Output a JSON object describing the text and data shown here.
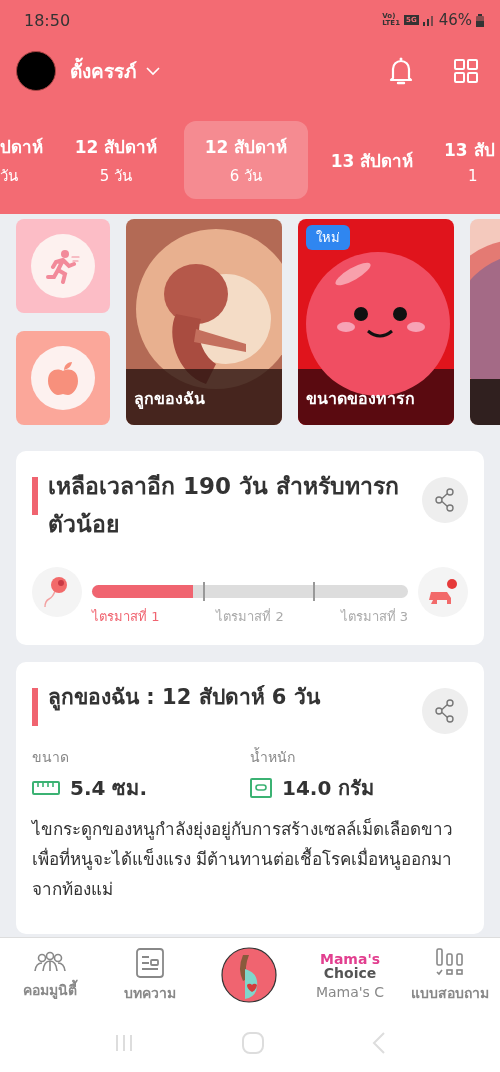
{
  "status_bar": {
    "time": "18:50",
    "volte": "Vo)\nLTE1",
    "network": "5G",
    "battery": "46%"
  },
  "header": {
    "profile_name": "ตั้งครรภ์"
  },
  "week_tabs": [
    {
      "week": "ปดาห์",
      "day": "วัน",
      "selected": false
    },
    {
      "week": "12 สัปดาห์",
      "day": "5 วัน",
      "selected": false
    },
    {
      "week": "12 สัปดาห์",
      "day": "6 วัน",
      "selected": true
    },
    {
      "week": "13 สัปดาห์",
      "selected": false
    },
    {
      "week": "13 สัป",
      "day": "1",
      "selected": false
    }
  ],
  "shortcuts": [
    {
      "kind": "exercise"
    },
    {
      "kind": "nutrition"
    }
  ],
  "feature_cards": [
    {
      "kind": "picture",
      "label": "ลูกของฉัน"
    },
    {
      "kind": "picture",
      "label": "ขนาดของทารก",
      "badge": "ใหม่"
    },
    {
      "kind": "picture"
    }
  ],
  "countdown_card": {
    "title": "เหลือเวลาอีก 190 วัน สำหรับทารกตัวน้อย",
    "level": 0.32,
    "trimesters": [
      {
        "label": "ไตรมาสที่ 1",
        "selected": true
      },
      {
        "label": "ไตรมาสที่ 2",
        "selected": false
      },
      {
        "label": "ไตรมาสที่ 3",
        "selected": false
      }
    ]
  },
  "baby_card": {
    "title": "ลูกของฉัน : 12 สัปดาห์ 6  วัน",
    "size_label": "ขนาด",
    "size_value": "5.4 ซม.",
    "weight_label": "น้ำหนัก",
    "weight_value": "14.0 กรัม",
    "description": "ไขกระดูกของหนูกำลังยุ่งอยู่กับการสร้างเซลล์เม็ดเลือดขาว เพื่อที่หนูจะได้แข็งแรง มีต้านทานต่อเชื้อโรคเมื่อหนูออกมาจากท้องแม่"
  },
  "bottom_nav": [
    {
      "kind": "community",
      "label": "คอมมูนิตี้"
    },
    {
      "kind": "articles",
      "label": "บทความ"
    },
    {
      "kind": "home"
    },
    {
      "kind": "brand",
      "logo_top": "Mama's",
      "logo_bottom": "Choice",
      "label": "Mama's C"
    },
    {
      "kind": "quiz",
      "label": "แบบสอบถาม"
    }
  ]
}
